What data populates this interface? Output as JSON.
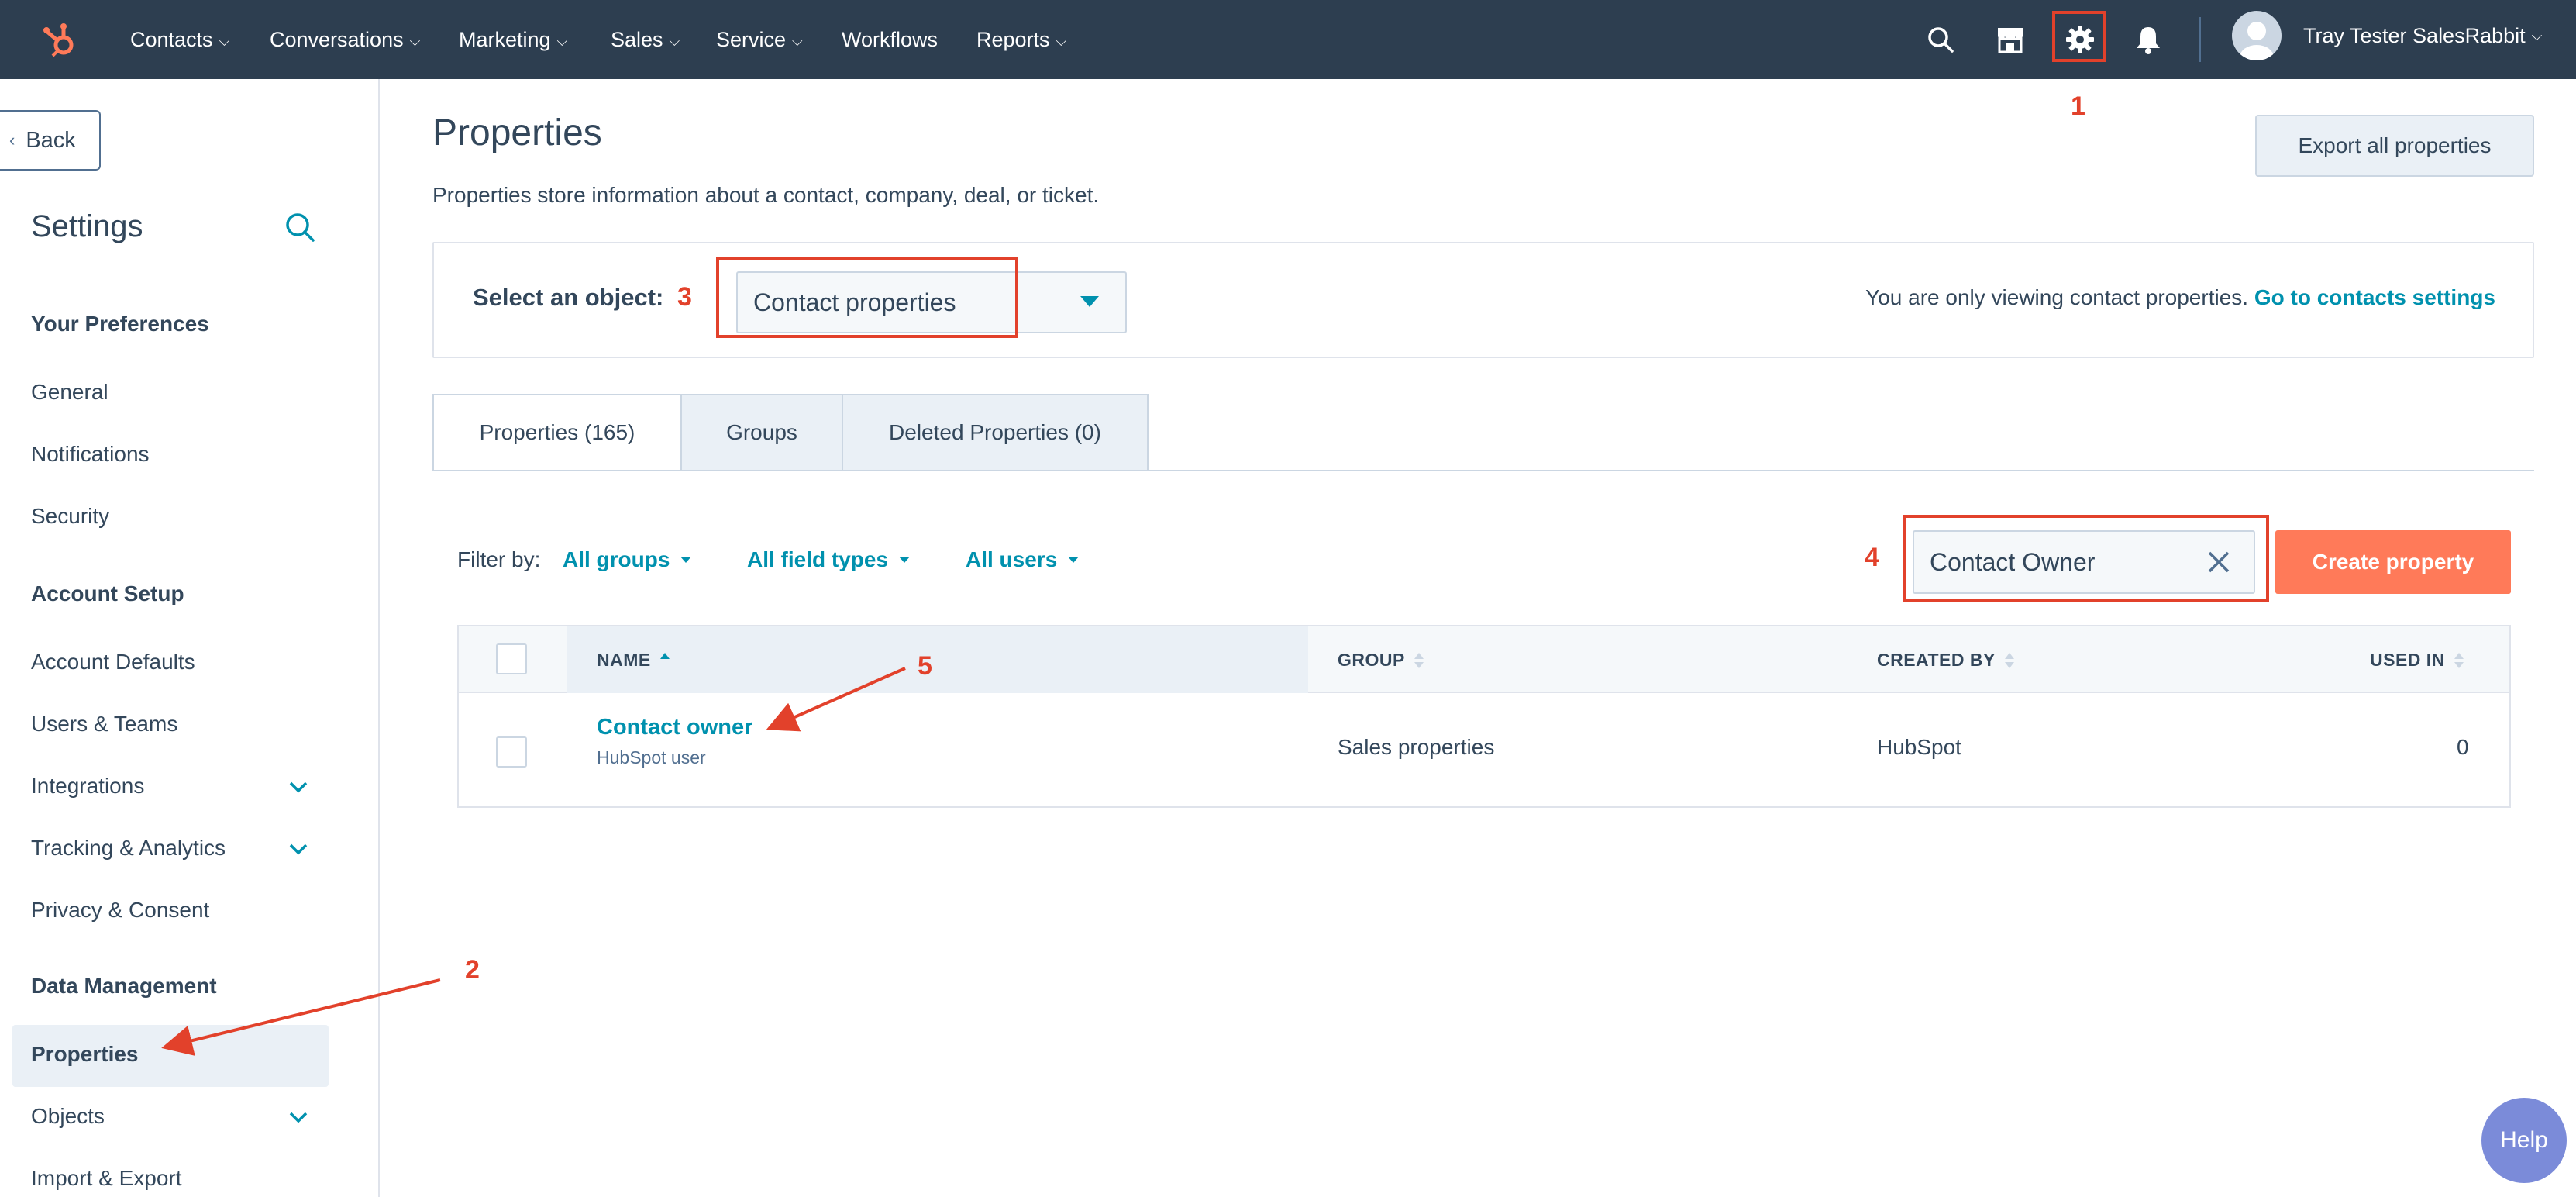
{
  "topnav": {
    "items": [
      {
        "label": "Contacts",
        "caret": "⌵"
      },
      {
        "label": "Conversations",
        "caret": "⌵"
      },
      {
        "label": "Marketing",
        "caret": "⌵"
      },
      {
        "label": "Sales",
        "caret": "⌵"
      },
      {
        "label": "Service",
        "caret": "⌵"
      },
      {
        "label": "Workflows",
        "caret": ""
      },
      {
        "label": "Reports",
        "caret": "⌵"
      }
    ],
    "icons": [
      "search-icon",
      "marketplace-icon",
      "settings-gear-icon",
      "notifications-bell-icon"
    ],
    "user_name": "Tray Tester SalesRabbit",
    "user_caret": "⌵",
    "background": "#2d3e50"
  },
  "sidebar": {
    "back_label": "Back",
    "back_chevron": "‹",
    "title": "Settings",
    "sections": [
      {
        "label": "Your Preferences",
        "items": [
          "General",
          "Notifications",
          "Security"
        ]
      },
      {
        "label": "Account Setup",
        "items": [
          "Account Defaults",
          "Users & Teams",
          "Integrations",
          "Tracking & Analytics",
          "Privacy & Consent"
        ]
      },
      {
        "label": "Data Management",
        "items": [
          "Properties",
          "Objects",
          "Import & Export"
        ]
      }
    ],
    "active_item": "Properties"
  },
  "main": {
    "title": "Properties",
    "description": "Properties store information about a contact, company, deal, or ticket.",
    "export_label": "Export all properties",
    "object_label": "Select an object:",
    "object_selected": "Contact properties",
    "object_note": "You are only viewing contact properties.",
    "object_link": "Go to contacts settings",
    "tabs": [
      "Properties (165)",
      "Groups",
      "Deleted Properties (0)"
    ],
    "filter_label": "Filter by:",
    "filters": [
      "All groups",
      "All field types",
      "All users"
    ],
    "search_value": "Contact Owner",
    "create_label": "Create property",
    "table": {
      "columns": [
        "NAME",
        "GROUP",
        "CREATED BY",
        "USED IN"
      ],
      "rows": [
        {
          "name": "Contact owner",
          "subtitle": "HubSpot user",
          "group": "Sales properties",
          "created_by": "HubSpot",
          "used_in": "0"
        }
      ]
    }
  },
  "annotations": [
    "1",
    "2",
    "3",
    "4",
    "5"
  ],
  "help_label": "Help",
  "colors": {
    "accent": "#0091ae",
    "cta": "#ff7a59",
    "annotation": "#e2412b"
  }
}
